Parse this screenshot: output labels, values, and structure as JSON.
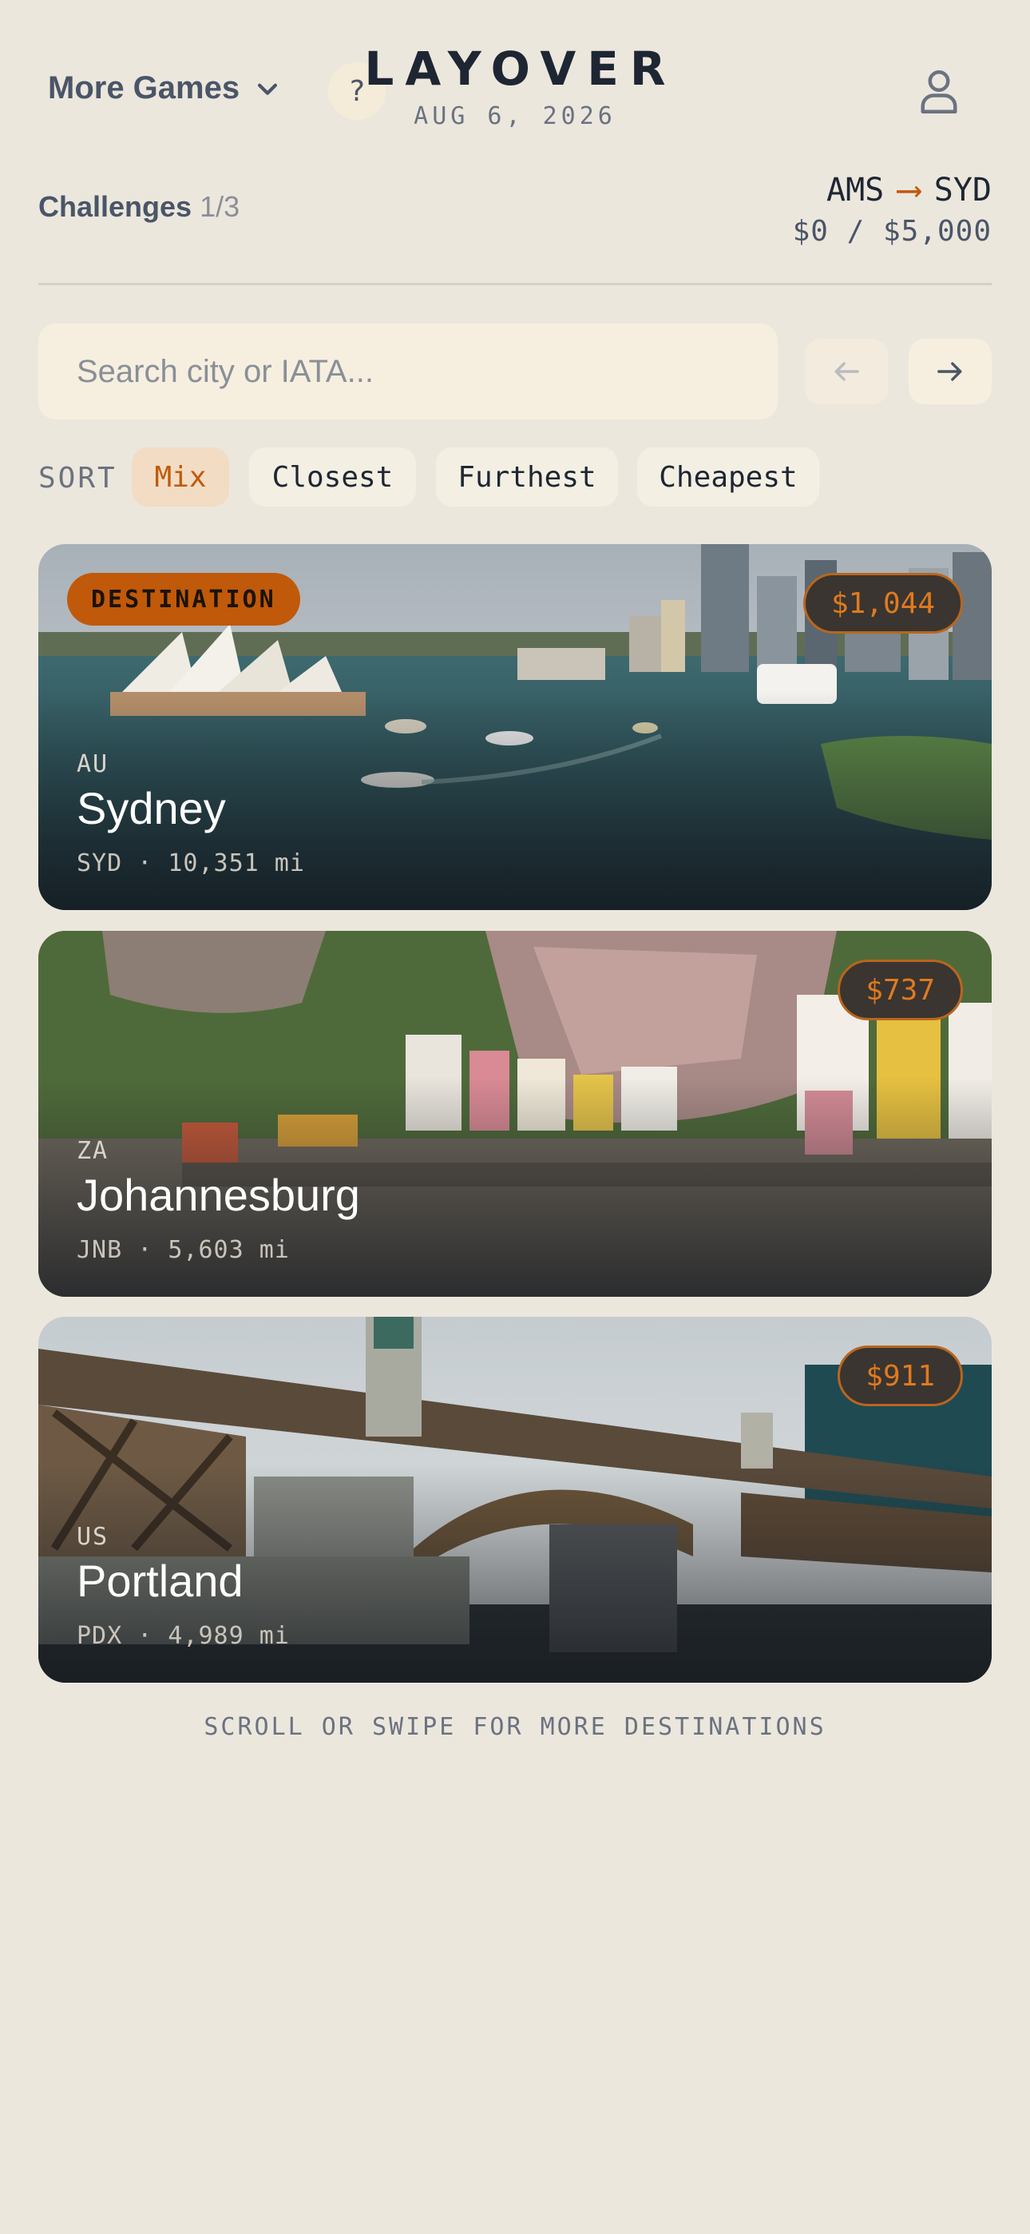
{
  "header": {
    "more_games_label": "More Games",
    "help_label": "?",
    "title": "LAYOVER",
    "date": "AUG 6, 2026"
  },
  "status": {
    "challenges_label": "Challenges",
    "challenges_count": "1/3",
    "origin": "AMS",
    "destination": "SYD",
    "arrow": "⟶",
    "budget": "$0 / $5,000"
  },
  "search": {
    "placeholder": "Search city or IATA..."
  },
  "sort": {
    "label": "SORT",
    "options": [
      "Mix",
      "Closest",
      "Furthest",
      "Cheapest"
    ],
    "selected": "Mix"
  },
  "cards": [
    {
      "badge": "DESTINATION",
      "price": "$1,044",
      "country": "AU",
      "city": "Sydney",
      "meta": "SYD · 10,351 mi"
    },
    {
      "badge": "",
      "price": "$737",
      "country": "ZA",
      "city": "Johannesburg",
      "meta": "JNB · 5,603 mi"
    },
    {
      "badge": "",
      "price": "$911",
      "country": "US",
      "city": "Portland",
      "meta": "PDX · 4,989 mi"
    }
  ],
  "footer_hint": "SCROLL OR SWIPE FOR MORE DESTINATIONS",
  "colors": {
    "background": "#ece7dd",
    "accent": "#c0590a",
    "text": "#1e2633"
  }
}
